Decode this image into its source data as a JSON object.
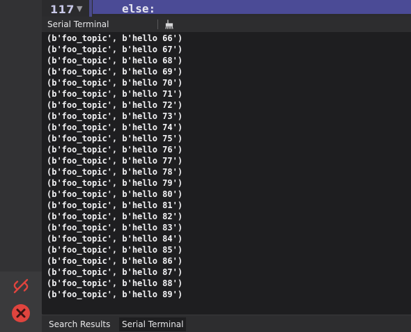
{
  "editor": {
    "line_number": "117",
    "fold_glyph": "▼",
    "code_line": "else:"
  },
  "panel": {
    "title": "Serial Terminal"
  },
  "terminal": {
    "lines": [
      "(b'foo_topic', b'hello 66')",
      "(b'foo_topic', b'hello 67')",
      "(b'foo_topic', b'hello 68')",
      "(b'foo_topic', b'hello 69')",
      "(b'foo_topic', b'hello 70')",
      "(b'foo_topic', b'hello 71')",
      "(b'foo_topic', b'hello 72')",
      "(b'foo_topic', b'hello 73')",
      "(b'foo_topic', b'hello 74')",
      "(b'foo_topic', b'hello 75')",
      "(b'foo_topic', b'hello 76')",
      "(b'foo_topic', b'hello 77')",
      "(b'foo_topic', b'hello 78')",
      "(b'foo_topic', b'hello 79')",
      "(b'foo_topic', b'hello 80')",
      "(b'foo_topic', b'hello 81')",
      "(b'foo_topic', b'hello 82')",
      "(b'foo_topic', b'hello 83')",
      "(b'foo_topic', b'hello 84')",
      "(b'foo_topic', b'hello 85')",
      "(b'foo_topic', b'hello 86')",
      "(b'foo_topic', b'hello 87')",
      "(b'foo_topic', b'hello 88')",
      "(b'foo_topic', b'hello 89')"
    ]
  },
  "tabs": [
    {
      "label": "Search Results",
      "active": false
    },
    {
      "label": "Serial Terminal",
      "active": true
    }
  ],
  "icons": {
    "disconnect": "unlink-icon",
    "stop": "stop-icon",
    "clear": "clear-icon"
  },
  "colors": {
    "error_red": "#e0443e",
    "code_highlight": "#4b4b96"
  }
}
